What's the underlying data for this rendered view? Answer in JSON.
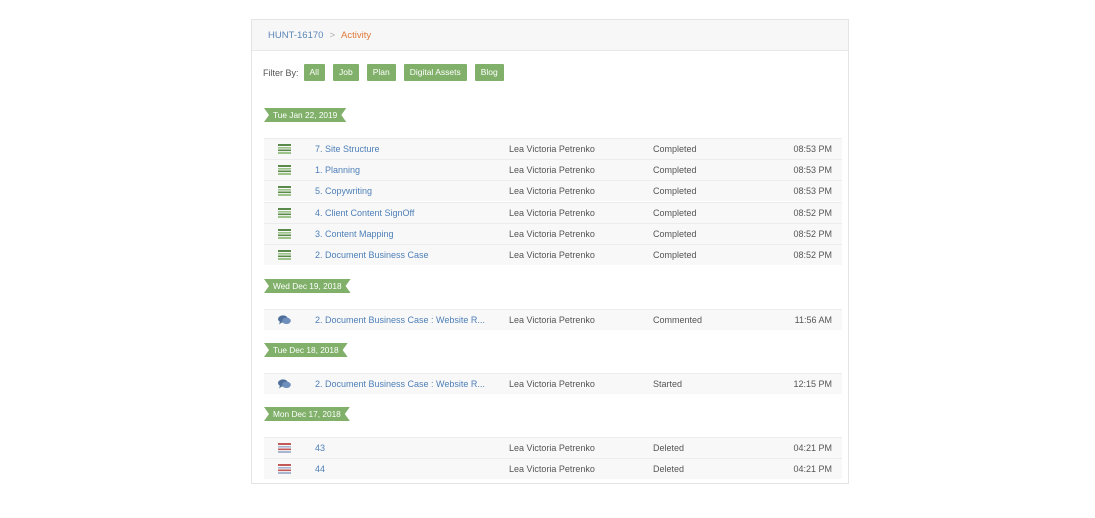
{
  "breadcrumb": {
    "project": "HUNT-16170",
    "separator": ">",
    "current": "Activity"
  },
  "filter": {
    "label": "Filter By:",
    "options": [
      "All",
      "Job",
      "Plan",
      "Digital Assets",
      "Blog"
    ]
  },
  "colors": {
    "accent_green": "#80b06a",
    "link_blue": "#4d7fb8",
    "breadcrumb_orange": "#e07b39"
  },
  "groups": [
    {
      "date": "Tue Jan 22, 2019",
      "items": [
        {
          "icon": "task-list-icon",
          "title": "7. Site Structure",
          "user": "Lea Victoria Petrenko",
          "status": "Completed",
          "time": "08:53 PM"
        },
        {
          "icon": "task-list-icon",
          "title": "1. Planning",
          "user": "Lea Victoria Petrenko",
          "status": "Completed",
          "time": "08:53 PM"
        },
        {
          "icon": "task-list-icon",
          "title": "5. Copywriting",
          "user": "Lea Victoria Petrenko",
          "status": "Completed",
          "time": "08:53 PM"
        },
        {
          "icon": "task-list-icon",
          "title": "4. Client Content SignOff",
          "user": "Lea Victoria Petrenko",
          "status": "Completed",
          "time": "08:52 PM"
        },
        {
          "icon": "task-list-icon",
          "title": "3. Content Mapping",
          "user": "Lea Victoria Petrenko",
          "status": "Completed",
          "time": "08:52 PM"
        },
        {
          "icon": "task-list-icon",
          "title": "2. Document Business Case",
          "user": "Lea Victoria Petrenko",
          "status": "Completed",
          "time": "08:52 PM"
        }
      ]
    },
    {
      "date": "Wed Dec 19, 2018",
      "items": [
        {
          "icon": "comment-icon",
          "title": "2. Document Business Case : Website R...",
          "user": "Lea Victoria Petrenko",
          "status": "Commented",
          "time": "11:56 AM"
        }
      ]
    },
    {
      "date": "Tue Dec 18, 2018",
      "items": [
        {
          "icon": "comment-icon",
          "title": "2. Document Business Case : Website R...",
          "user": "Lea Victoria Petrenko",
          "status": "Started",
          "time": "12:15 PM"
        }
      ]
    },
    {
      "date": "Mon Dec 17, 2018",
      "items": [
        {
          "icon": "deleted-list-icon",
          "title": "43",
          "user": "Lea Victoria Petrenko",
          "status": "Deleted",
          "time": "04:21 PM"
        },
        {
          "icon": "deleted-list-icon",
          "title": "44",
          "user": "Lea Victoria Petrenko",
          "status": "Deleted",
          "time": "04:21 PM"
        }
      ]
    }
  ]
}
